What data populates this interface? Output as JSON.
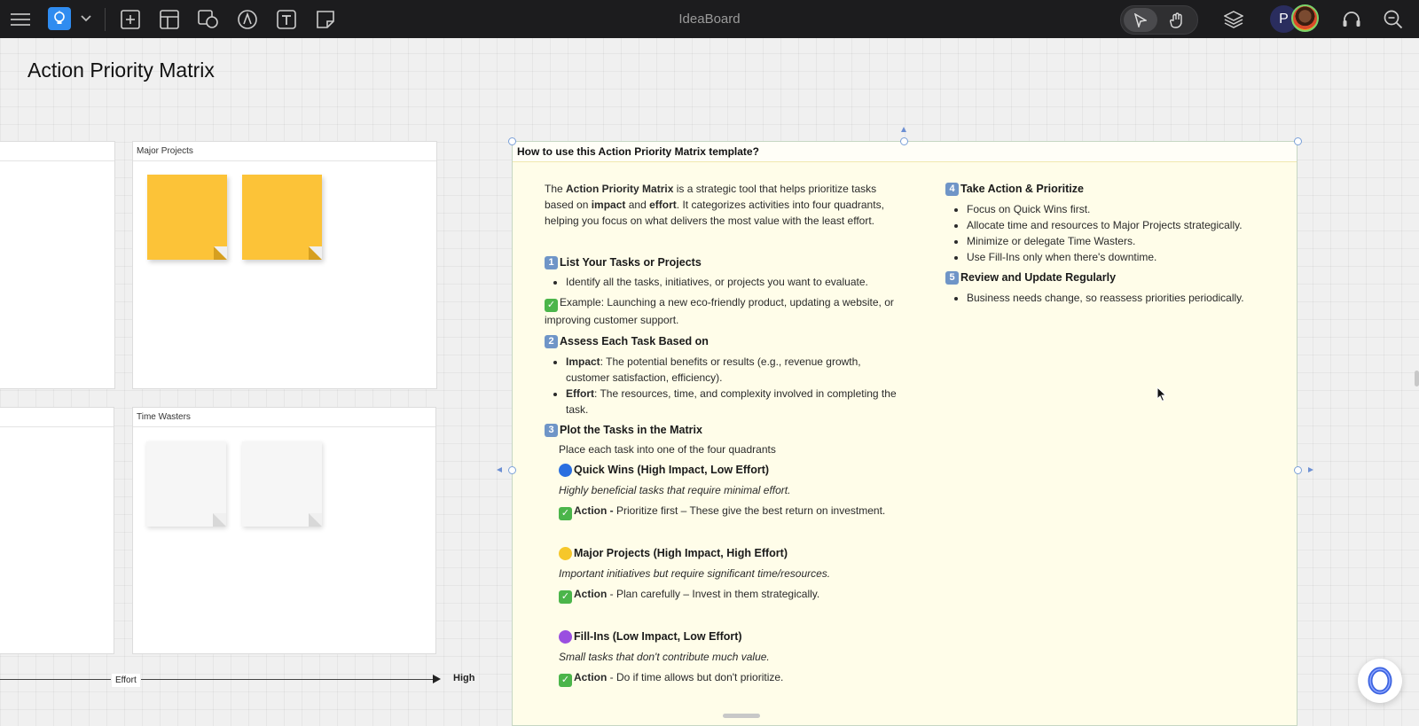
{
  "app": {
    "title": "IdeaBoard"
  },
  "toolbar": {
    "icons": [
      "menu-icon",
      "idea-bulb-icon",
      "chevron-down-icon",
      "add-frame-icon",
      "layout-template-icon",
      "shapes-media-icon",
      "pen-draw-icon",
      "text-tool-icon",
      "sticky-note-icon",
      "select-pointer-icon",
      "hand-pan-icon",
      "layers-icon",
      "headset-icon",
      "zoom-icon"
    ],
    "user_initial": "P",
    "accent_color": "#2f8cf0"
  },
  "board": {
    "title": "Action Priority Matrix",
    "quadrants": {
      "major_projects": "Major Projects",
      "time_wasters": "Time Wasters"
    },
    "axis": {
      "label": "Effort",
      "high_label": "High"
    },
    "sticky_colors": {
      "yellow": "#fcc338",
      "blank": "#f6f6f6"
    }
  },
  "card": {
    "title": "How to use this Action Priority Matrix template?",
    "intro": {
      "t1": "The ",
      "b1": "Action Priority Matrix",
      "t2": " is a strategic tool that helps prioritize tasks based on ",
      "b2": "impact",
      "t3": " and ",
      "b3": "effort",
      "t4": ". It categorizes activities into four quadrants, helping you focus on what delivers the most value with the least effort."
    },
    "step1": {
      "num": "1",
      "title": "List Your Tasks or Projects",
      "bullet": "Identify all the tasks, initiatives, or projects you want to evaluate.",
      "example": "Example: Launching a new eco-friendly product, updating a website, or improving customer support."
    },
    "step2": {
      "num": "2",
      "title": "Assess Each Task Based on",
      "impact_label": "Impact",
      "impact_text": ": The potential benefits or results (e.g., revenue growth, customer satisfaction, efficiency).",
      "effort_label": "Effort",
      "effort_text": ": The resources, time, and complexity involved in completing the task."
    },
    "step3": {
      "num": "3",
      "title": "Plot the Tasks in the Matrix",
      "subtitle": "Place each task into one of the four quadrants",
      "quick_wins": {
        "title": "Quick Wins (High Impact, Low Effort)",
        "desc": "Highly beneficial tasks that require minimal effort.",
        "action_label": "Action - ",
        "action_text": "Prioritize first – These give the best return on investment.",
        "color": "#2a6fe0"
      },
      "major_projects": {
        "title": "Major Projects (High Impact, High Effort)",
        "desc": "Important initiatives but require significant time/resources.",
        "action_label": "Action",
        "action_text": " - Plan carefully – Invest in them strategically.",
        "color": "#f6c72a"
      },
      "fill_ins": {
        "title": "Fill-Ins (Low Impact, Low Effort)",
        "desc": "Small tasks that don't contribute much value.",
        "action_label": "Action",
        "action_text": " - Do if time allows but don't prioritize.",
        "color": "#9a4fe0"
      }
    },
    "step4": {
      "num": "4",
      "title": "Take Action & Prioritize",
      "bullets": [
        "Focus on Quick Wins first.",
        "Allocate time and resources to Major Projects strategically.",
        "Minimize or delegate Time Wasters.",
        "Use Fill-Ins only when there's downtime."
      ]
    },
    "step5": {
      "num": "5",
      "title": "Review and Update Regularly",
      "bullet": "Business needs change, so reassess priorities periodically."
    }
  }
}
